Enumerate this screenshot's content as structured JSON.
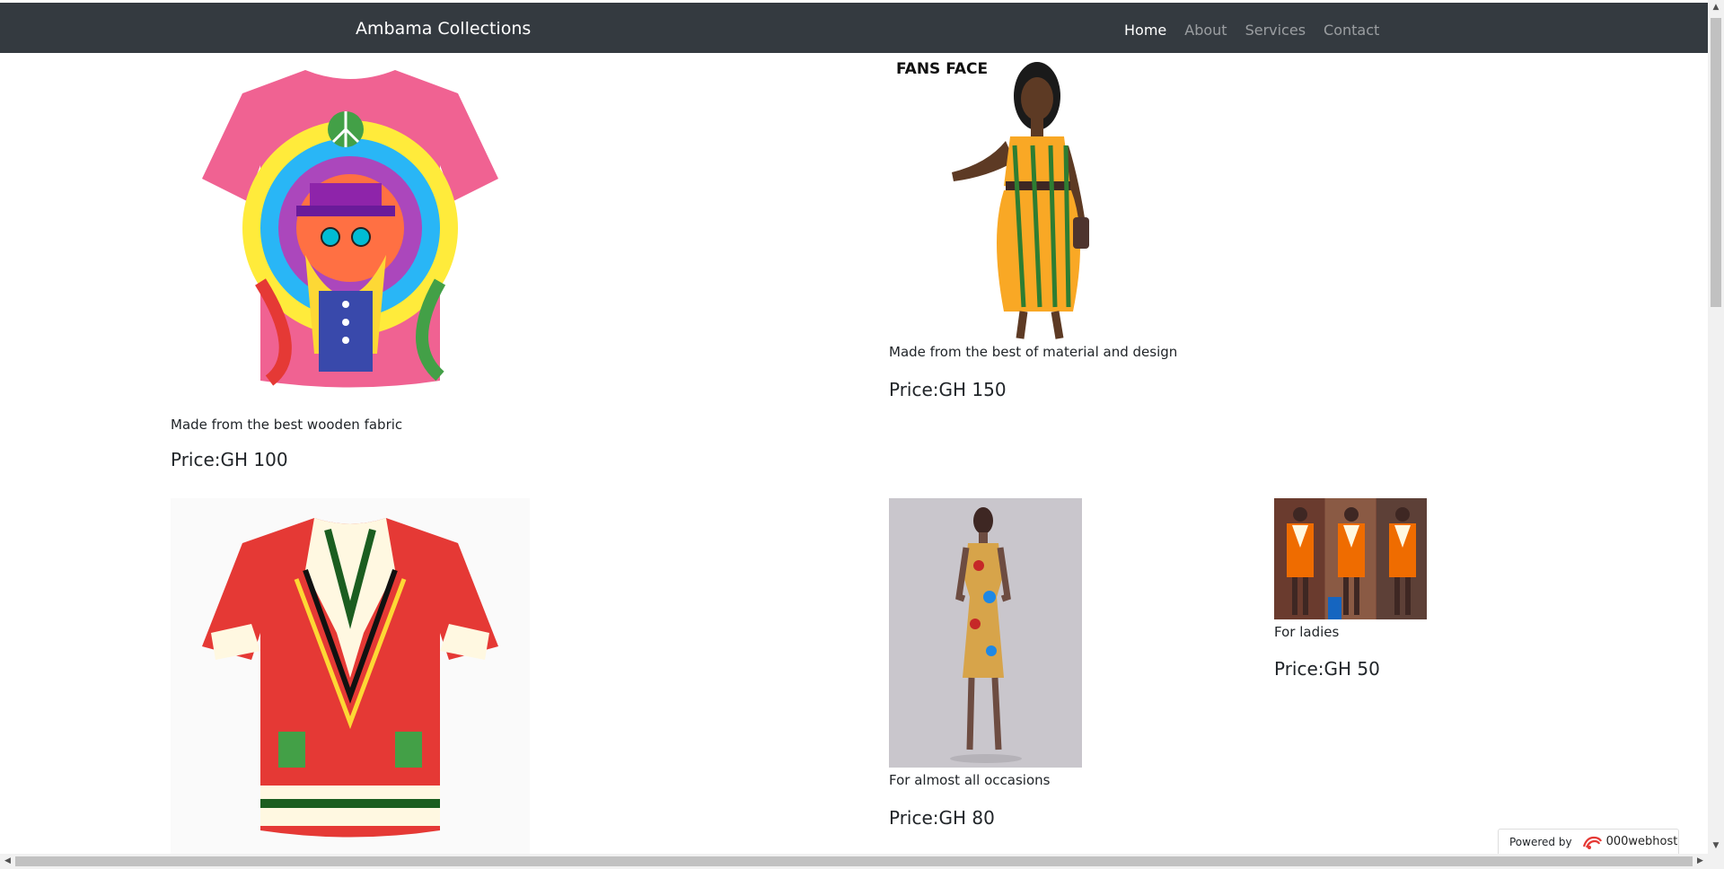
{
  "navbar": {
    "brand": "Ambama Collections",
    "links": [
      {
        "label": "Home",
        "active": true
      },
      {
        "label": "About",
        "active": false
      },
      {
        "label": "Services",
        "active": false
      },
      {
        "label": "Contact",
        "active": false
      }
    ]
  },
  "products": [
    {
      "description": "Made from the best wooden fabric",
      "price": "Price:GH 100",
      "image": "psychedelic-tshirt"
    },
    {
      "description": "Made from the best of material and design",
      "price": "Price:GH 150",
      "image": "ankara-dress-model",
      "watermark": "FANS FACE"
    },
    {
      "description": "",
      "price": "",
      "image": "dashiki-shirt"
    },
    {
      "description": "For almost all occasions",
      "price": "Price:GH 80",
      "image": "paisley-dress-model"
    },
    {
      "description": "For ladies",
      "price": "Price:GH 50",
      "image": "dashiki-dress-trio"
    }
  ],
  "badge": {
    "prefix": "Powered by",
    "brand": "000webhost"
  },
  "colors": {
    "navbar": "#343a40",
    "text": "#212529"
  }
}
